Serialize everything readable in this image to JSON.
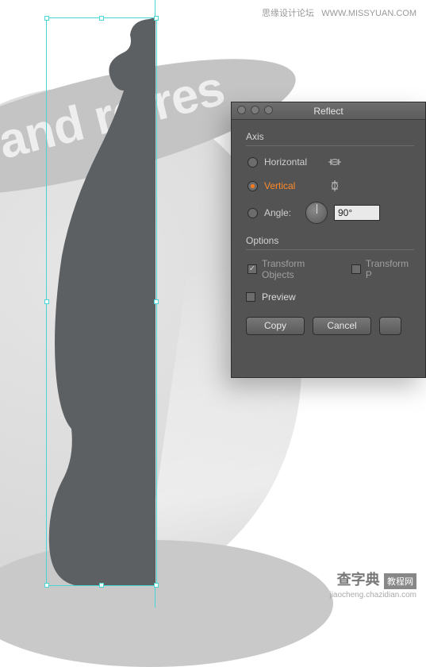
{
  "watermark": {
    "top_cn": "思缘设计论坛",
    "top_url": "WWW.MISSYUAN.COM",
    "bottom_brand_cn": "查字典",
    "bottom_brand_box": "教程网",
    "bottom_url": "jiaocheng.chazidian.com"
  },
  "artwork": {
    "band_text": "us and refres"
  },
  "dialog": {
    "title": "Reflect",
    "axis": {
      "group_label": "Axis",
      "horizontal": {
        "label": "Horizontal",
        "selected": false
      },
      "vertical": {
        "label": "Vertical",
        "selected": true
      },
      "angle": {
        "label": "Angle:",
        "value": "90°"
      }
    },
    "options": {
      "group_label": "Options",
      "transform_objects": {
        "label": "Transform Objects",
        "checked": true
      },
      "transform_patterns": {
        "label": "Transform P",
        "checked": false
      }
    },
    "preview": {
      "label": "Preview",
      "checked": false
    },
    "buttons": {
      "copy": "Copy",
      "cancel": "Cancel"
    }
  }
}
